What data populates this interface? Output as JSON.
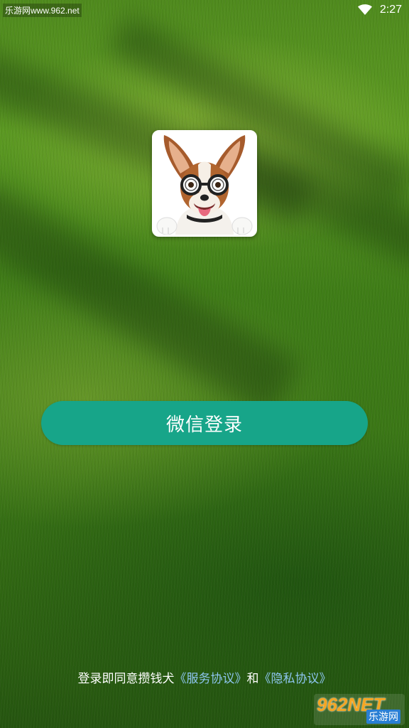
{
  "status_bar": {
    "watermark": "乐游网www.962.net",
    "time": "2:27"
  },
  "avatar": {
    "icon": "dog-with-glasses"
  },
  "login": {
    "button_label": "微信登录",
    "button_color": "#17a589"
  },
  "agreement": {
    "prefix": "登录即同意攒钱犬",
    "service_link": "《服务协议》",
    "conjunction": "和",
    "privacy_link": "《隐私协议》"
  },
  "watermark_badge": {
    "brand": "962NET",
    "name": "乐游网"
  }
}
